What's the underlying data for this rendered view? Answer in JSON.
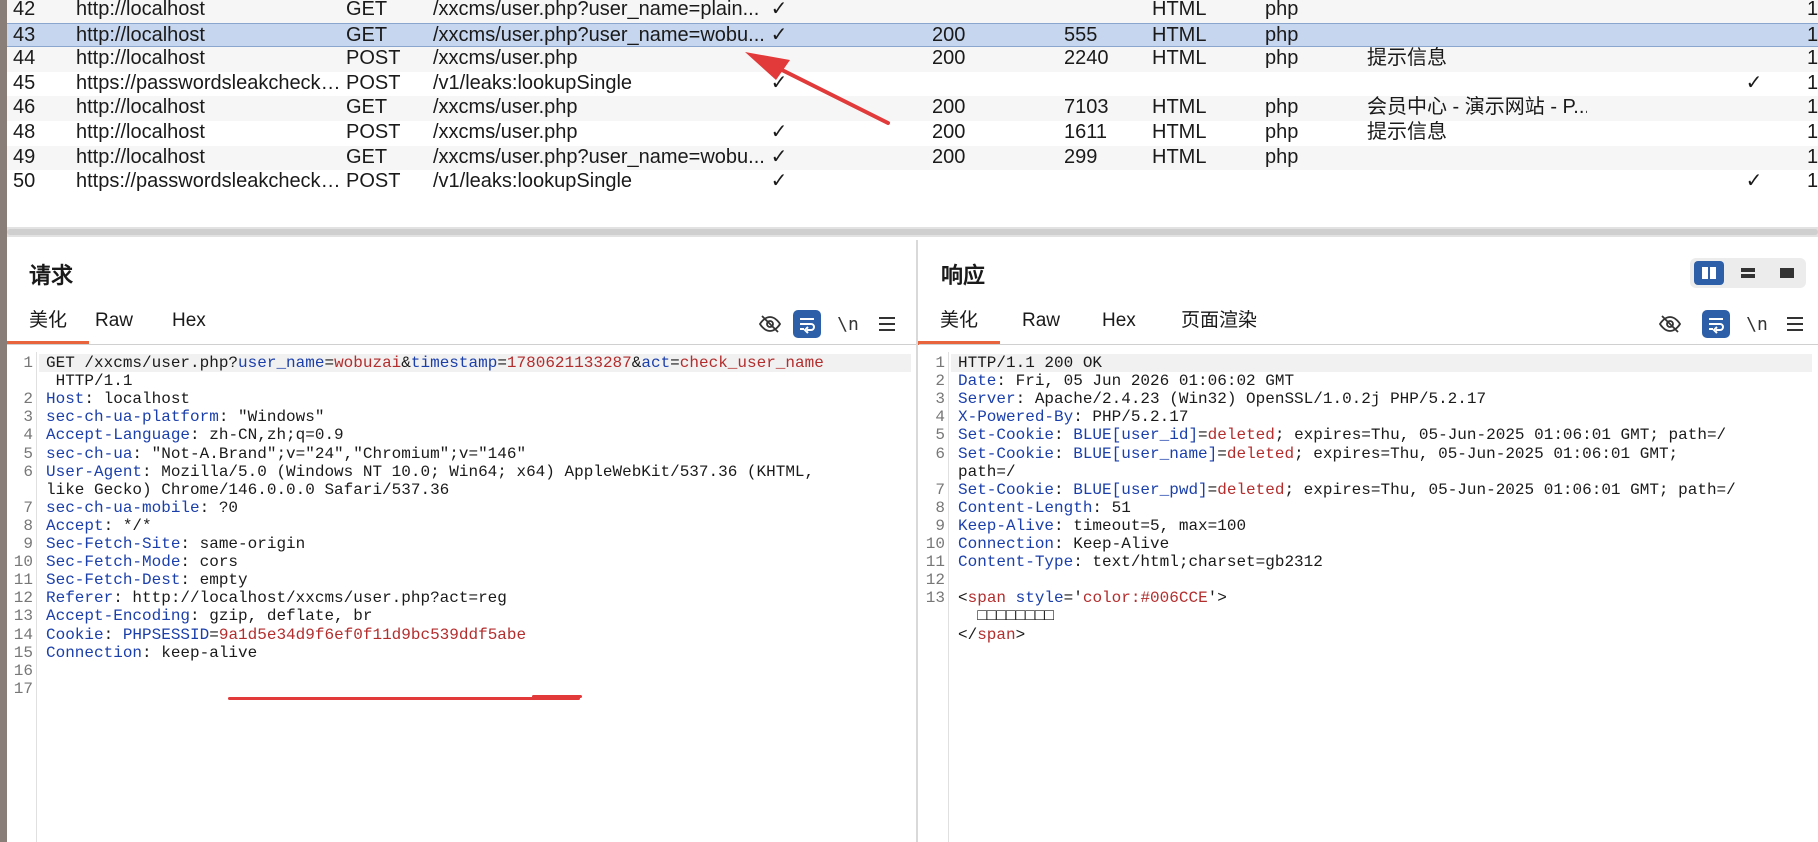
{
  "history": {
    "rows": [
      {
        "num": "42",
        "host": "http://localhost",
        "method": "GET",
        "url": "/xxcms/user.php?user_name=plain...",
        "params": "✓",
        "status": "",
        "length": "",
        "mime": "HTML",
        "ext": "php",
        "title": "",
        "tls": "",
        "ip": "1",
        "selected": false
      },
      {
        "num": "43",
        "host": "http://localhost",
        "method": "GET",
        "url": "/xxcms/user.php?user_name=wobu...",
        "params": "✓",
        "status": "200",
        "length": "555",
        "mime": "HTML",
        "ext": "php",
        "title": "",
        "tls": "",
        "ip": "1",
        "selected": true
      },
      {
        "num": "44",
        "host": "http://localhost",
        "method": "POST",
        "url": "/xxcms/user.php",
        "params": "",
        "status": "200",
        "length": "2240",
        "mime": "HTML",
        "ext": "php",
        "title": "提示信息",
        "tls": "",
        "ip": "1",
        "selected": false
      },
      {
        "num": "45",
        "host": "https://passwordsleakcheck-...",
        "method": "POST",
        "url": "/v1/leaks:lookupSingle",
        "params": "✓",
        "status": "",
        "length": "",
        "mime": "",
        "ext": "",
        "title": "",
        "tls": "✓",
        "ip": "1",
        "selected": false
      },
      {
        "num": "46",
        "host": "http://localhost",
        "method": "GET",
        "url": "/xxcms/user.php",
        "params": "",
        "status": "200",
        "length": "7103",
        "mime": "HTML",
        "ext": "php",
        "title": "会员中心 - 演示网站 - P...",
        "tls": "",
        "ip": "1",
        "selected": false
      },
      {
        "num": "48",
        "host": "http://localhost",
        "method": "POST",
        "url": "/xxcms/user.php",
        "params": "✓",
        "status": "200",
        "length": "1611",
        "mime": "HTML",
        "ext": "php",
        "title": "提示信息",
        "tls": "",
        "ip": "1",
        "selected": false
      },
      {
        "num": "49",
        "host": "http://localhost",
        "method": "GET",
        "url": "/xxcms/user.php?user_name=wobu...",
        "params": "✓",
        "status": "200",
        "length": "299",
        "mime": "HTML",
        "ext": "php",
        "title": "",
        "tls": "",
        "ip": "1",
        "selected": false
      },
      {
        "num": "50",
        "host": "https://passwordsleakcheck-...",
        "method": "POST",
        "url": "/v1/leaks:lookupSingle",
        "params": "✓",
        "status": "",
        "length": "",
        "mime": "",
        "ext": "",
        "title": "",
        "tls": "✓",
        "ip": "1",
        "selected": false
      }
    ]
  },
  "request": {
    "title": "请求",
    "tabs": [
      "美化",
      "Raw",
      "Hex"
    ],
    "active_tab": "美化",
    "newline_label": "\\n",
    "lines": [
      {
        "n": "1",
        "parts": [
          [
            "t",
            "GET /xxcms/user.php?"
          ],
          [
            "k",
            "user_name"
          ],
          [
            "t",
            "="
          ],
          [
            "v",
            "wobuzai"
          ],
          [
            "t",
            "&"
          ],
          [
            "k",
            "timestamp"
          ],
          [
            "t",
            "="
          ],
          [
            "v",
            "1780621133287"
          ],
          [
            "t",
            "&"
          ],
          [
            "k",
            "act"
          ],
          [
            "t",
            "="
          ],
          [
            "v",
            "check_user_name"
          ]
        ]
      },
      {
        "n": "",
        "parts": [
          [
            "t",
            " HTTP/1.1"
          ]
        ]
      },
      {
        "n": "2",
        "parts": [
          [
            "k",
            "Host"
          ],
          [
            "t",
            ": localhost"
          ]
        ]
      },
      {
        "n": "3",
        "parts": [
          [
            "k",
            "sec-ch-ua-platform"
          ],
          [
            "t",
            ": \"Windows\""
          ]
        ]
      },
      {
        "n": "4",
        "parts": [
          [
            "k",
            "Accept-Language"
          ],
          [
            "t",
            ": zh-CN,zh;q=0.9"
          ]
        ]
      },
      {
        "n": "5",
        "parts": [
          [
            "k",
            "sec-ch-ua"
          ],
          [
            "t",
            ": \"Not-A.Brand\";v=\"24\",\"Chromium\";v=\"146\""
          ]
        ]
      },
      {
        "n": "6",
        "parts": [
          [
            "k",
            "User-Agent"
          ],
          [
            "t",
            ": Mozilla/5.0 (Windows NT 10.0; Win64; x64) AppleWebKit/537.36 (KHTML,"
          ]
        ]
      },
      {
        "n": "",
        "parts": [
          [
            "t",
            "like Gecko) Chrome/146.0.0.0 Safari/537.36"
          ]
        ]
      },
      {
        "n": "7",
        "parts": [
          [
            "k",
            "sec-ch-ua-mobile"
          ],
          [
            "t",
            ": ?0"
          ]
        ]
      },
      {
        "n": "8",
        "parts": [
          [
            "k",
            "Accept"
          ],
          [
            "t",
            ": */*"
          ]
        ]
      },
      {
        "n": "9",
        "parts": [
          [
            "k",
            "Sec-Fetch-Site"
          ],
          [
            "t",
            ": same-origin"
          ]
        ]
      },
      {
        "n": "10",
        "parts": [
          [
            "k",
            "Sec-Fetch-Mode"
          ],
          [
            "t",
            ": cors"
          ]
        ]
      },
      {
        "n": "11",
        "parts": [
          [
            "k",
            "Sec-Fetch-Dest"
          ],
          [
            "t",
            ": empty"
          ]
        ]
      },
      {
        "n": "12",
        "parts": [
          [
            "k",
            "Referer"
          ],
          [
            "t",
            ": http://localhost/xxcms/user.php?act=reg"
          ]
        ]
      },
      {
        "n": "13",
        "parts": [
          [
            "k",
            "Accept-Encoding"
          ],
          [
            "t",
            ": gzip, deflate, br"
          ]
        ]
      },
      {
        "n": "14",
        "parts": [
          [
            "k",
            "Cookie"
          ],
          [
            "t",
            ": "
          ],
          [
            "k",
            "PHPSESSID"
          ],
          [
            "t",
            "="
          ],
          [
            "v",
            "9a1d5e34d9f6ef0f11d9bc539ddf5abe"
          ]
        ]
      },
      {
        "n": "15",
        "parts": [
          [
            "k",
            "Connection"
          ],
          [
            "t",
            ": keep-alive"
          ]
        ]
      },
      {
        "n": "16",
        "parts": []
      },
      {
        "n": "17",
        "parts": []
      }
    ]
  },
  "response": {
    "title": "响应",
    "tabs": [
      "美化",
      "Raw",
      "Hex",
      "页面渲染"
    ],
    "active_tab": "美化",
    "newline_label": "\\n",
    "lines": [
      {
        "n": "1",
        "parts": [
          [
            "t",
            "HTTP/1.1 200 OK"
          ]
        ]
      },
      {
        "n": "2",
        "parts": [
          [
            "k",
            "Date"
          ],
          [
            "t",
            ": Fri, 05 Jun 2026 01:06:02 GMT"
          ]
        ]
      },
      {
        "n": "3",
        "parts": [
          [
            "k",
            "Server"
          ],
          [
            "t",
            ": Apache/2.4.23 (Win32) OpenSSL/1.0.2j PHP/5.2.17"
          ]
        ]
      },
      {
        "n": "4",
        "parts": [
          [
            "k",
            "X-Powered-By"
          ],
          [
            "t",
            ": PHP/5.2.17"
          ]
        ]
      },
      {
        "n": "5",
        "parts": [
          [
            "k",
            "Set-Cookie"
          ],
          [
            "t",
            ": "
          ],
          [
            "k",
            "BLUE[user_id]"
          ],
          [
            "t",
            "="
          ],
          [
            "v",
            "deleted"
          ],
          [
            "t",
            "; expires=Thu, 05-Jun-2025 01:06:01 GMT; path=/"
          ]
        ]
      },
      {
        "n": "6",
        "parts": [
          [
            "k",
            "Set-Cookie"
          ],
          [
            "t",
            ": "
          ],
          [
            "k",
            "BLUE[user_name]"
          ],
          [
            "t",
            "="
          ],
          [
            "v",
            "deleted"
          ],
          [
            "t",
            "; expires=Thu, 05-Jun-2025 01:06:01 GMT;"
          ]
        ]
      },
      {
        "n": "",
        "parts": [
          [
            "t",
            "path=/"
          ]
        ]
      },
      {
        "n": "7",
        "parts": [
          [
            "k",
            "Set-Cookie"
          ],
          [
            "t",
            ": "
          ],
          [
            "k",
            "BLUE[user_pwd]"
          ],
          [
            "t",
            "="
          ],
          [
            "v",
            "deleted"
          ],
          [
            "t",
            "; expires=Thu, 05-Jun-2025 01:06:01 GMT; path=/"
          ]
        ]
      },
      {
        "n": "8",
        "parts": [
          [
            "k",
            "Content-Length"
          ],
          [
            "t",
            ": 51"
          ]
        ]
      },
      {
        "n": "9",
        "parts": [
          [
            "k",
            "Keep-Alive"
          ],
          [
            "t",
            ": timeout=5, max=100"
          ]
        ]
      },
      {
        "n": "10",
        "parts": [
          [
            "k",
            "Connection"
          ],
          [
            "t",
            ": Keep-Alive"
          ]
        ]
      },
      {
        "n": "11",
        "parts": [
          [
            "k",
            "Content-Type"
          ],
          [
            "t",
            ": text/html;charset=gb2312"
          ]
        ]
      },
      {
        "n": "12",
        "parts": []
      },
      {
        "n": "13",
        "parts": [
          [
            "t",
            "<"
          ],
          [
            "v",
            "span"
          ],
          [
            "t",
            " "
          ],
          [
            "k",
            "style"
          ],
          [
            "t",
            "='"
          ],
          [
            "v",
            "color:#006CCE"
          ],
          [
            "t",
            "'>"
          ]
        ]
      },
      {
        "n": "",
        "parts": [
          [
            "t",
            "  □□□□□□□□"
          ]
        ]
      },
      {
        "n": "",
        "parts": [
          [
            "t",
            "</"
          ],
          [
            "v",
            "span"
          ],
          [
            "t",
            ">"
          ]
        ]
      }
    ]
  },
  "colors": {
    "accent": "#e8643c",
    "selected_row": "#c6d6ee",
    "key_blue": "#1b3faa",
    "value_red": "#b32d2d",
    "annotation_red": "#e23a3a",
    "toggle_blue": "#2c5fa8"
  },
  "icons": {
    "hide": "eye-slash-icon",
    "wrap": "wrap-lines-icon",
    "menu": "hamburger-menu-icon",
    "layout": [
      "split-horizontal-icon",
      "split-vertical-icon",
      "single-pane-icon"
    ]
  }
}
